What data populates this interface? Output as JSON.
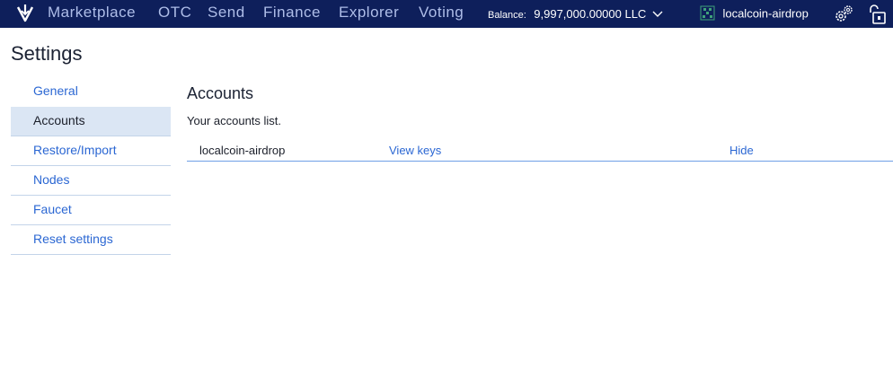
{
  "header": {
    "logo_icon": "localcoin-logo-icon",
    "nav": [
      {
        "label": "Marketplace"
      },
      {
        "label": "OTC"
      },
      {
        "label": "Send"
      },
      {
        "label": "Finance"
      },
      {
        "label": "Explorer"
      },
      {
        "label": "Voting"
      }
    ],
    "balance_label": "Balance:",
    "balance_value": "9,997,000.00000 LLC",
    "account_name": "localcoin-airdrop",
    "icons": [
      "chevron-down-icon",
      "account-avatar-icon",
      "gears-icon",
      "unlocked-lock-icon"
    ],
    "background_color": "#0e1f5b",
    "nav_color": "#aebde8"
  },
  "page_title": "Settings",
  "sidebar": {
    "items": [
      {
        "label": "General",
        "active": false
      },
      {
        "label": "Accounts",
        "active": true
      },
      {
        "label": "Restore/Import",
        "active": false
      },
      {
        "label": "Nodes",
        "active": false
      },
      {
        "label": "Faucet",
        "active": false
      },
      {
        "label": "Reset settings",
        "active": false
      }
    ],
    "active_background": "#dbe6f4",
    "link_color": "#2b67d3"
  },
  "main": {
    "title": "Accounts",
    "subtitle": "Your accounts list.",
    "accounts": [
      {
        "name": "localcoin-airdrop",
        "view_label": "View keys",
        "hide_label": "Hide"
      }
    ]
  }
}
